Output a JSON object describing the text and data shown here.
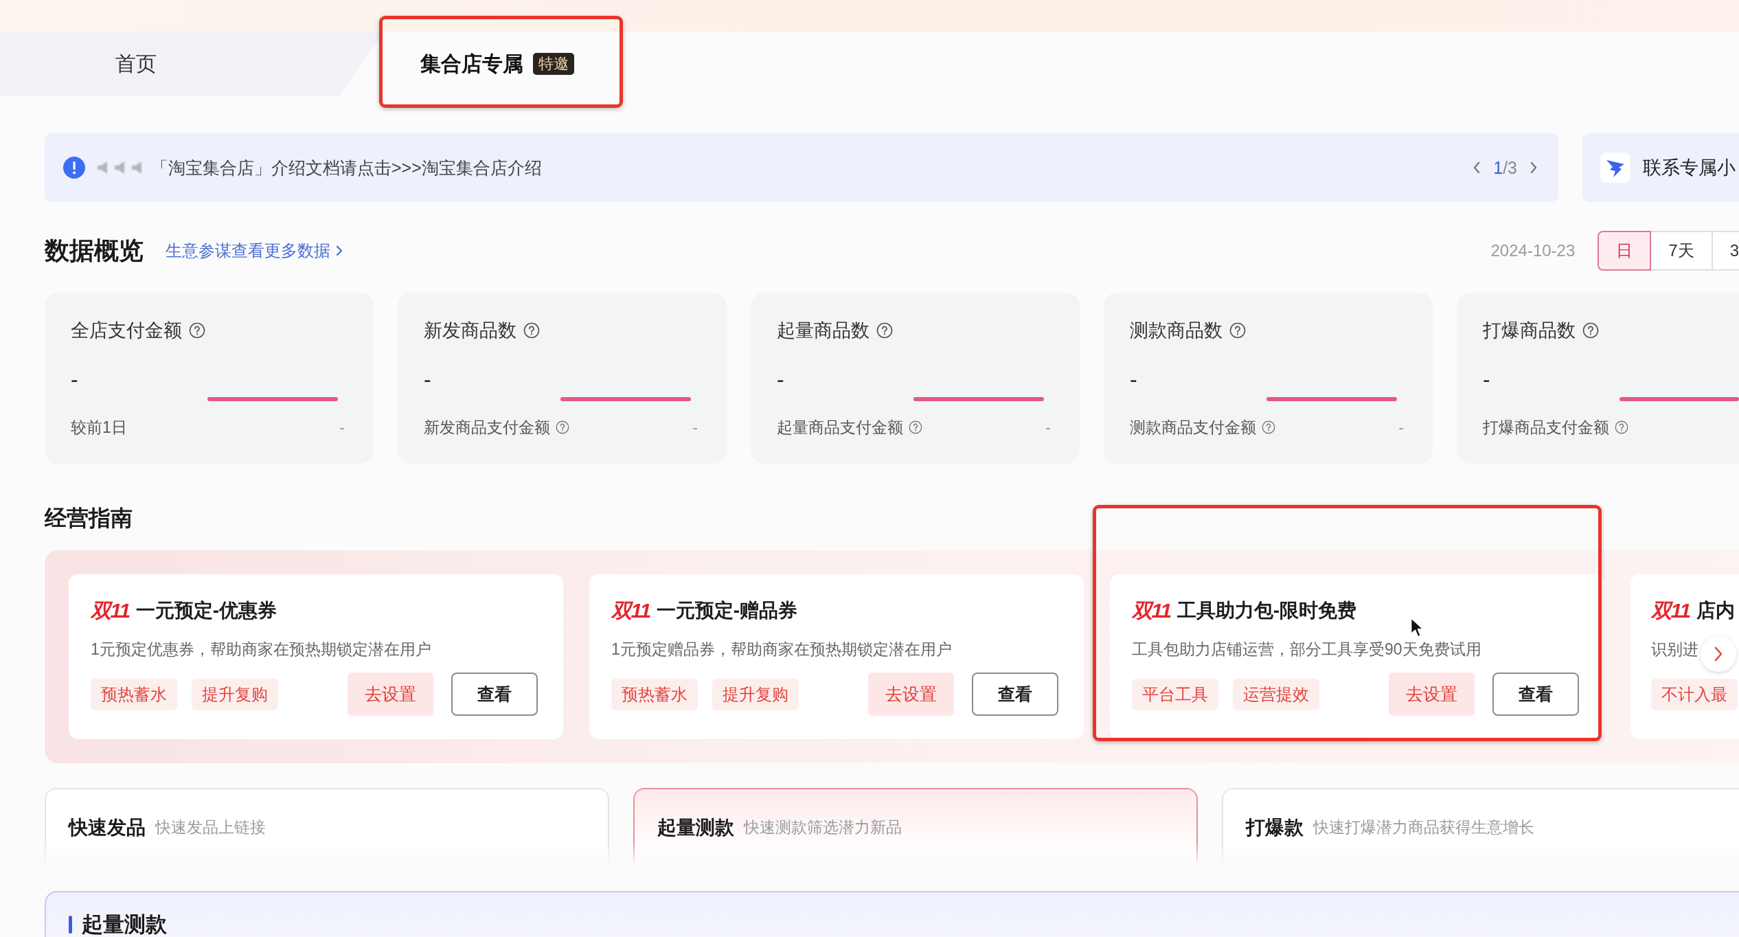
{
  "tabs": [
    {
      "label": "首页",
      "selected": false,
      "highlighted": false
    },
    {
      "label": "集合店专属",
      "badge": "特邀",
      "selected": true,
      "highlighted": true
    }
  ],
  "notice": {
    "text": "「淘宝集合店」介绍文档请点击>>>淘宝集合店介绍",
    "page": "1",
    "page_total": "/3"
  },
  "contact": {
    "label": "联系专属小"
  },
  "overview": {
    "title": "数据概览",
    "link": "生意参谋查看更多数据",
    "date": "2024-10-23",
    "ranges": [
      {
        "label": "日",
        "selected": true
      },
      {
        "label": "7天",
        "selected": false
      },
      {
        "label": "3",
        "selected": false
      }
    ],
    "metrics": [
      {
        "title": "全店支付金额",
        "value": "-",
        "footer_label": "较前1日",
        "footer_help": false,
        "footer_value": "-"
      },
      {
        "title": "新发商品数",
        "value": "-",
        "footer_label": "新发商品支付金额",
        "footer_help": true,
        "footer_value": "-"
      },
      {
        "title": "起量商品数",
        "value": "-",
        "footer_label": "起量商品支付金额",
        "footer_help": true,
        "footer_value": "-"
      },
      {
        "title": "测款商品数",
        "value": "-",
        "footer_label": "测款商品支付金额",
        "footer_help": true,
        "footer_value": "-"
      },
      {
        "title": "打爆商品数",
        "value": "-",
        "footer_label": "打爆商品支付金额",
        "footer_help": true
      }
    ]
  },
  "guide": {
    "title": "经营指南",
    "cards": [
      {
        "logo": "双11",
        "title": "一元预定-优惠券",
        "description": "1元预定优惠券，帮助商家在预热期锁定潜在用户",
        "tags": [
          "预热蓄水",
          "提升复购"
        ],
        "primary": "去设置",
        "secondary": "查看",
        "highlighted": false
      },
      {
        "logo": "双11",
        "title": "一元预定-赠品券",
        "description": "1元预定赠品券，帮助商家在预热期锁定潜在用户",
        "tags": [
          "预热蓄水",
          "提升复购"
        ],
        "primary": "去设置",
        "secondary": "查看",
        "highlighted": false
      },
      {
        "logo": "双11",
        "title": "工具助力包-限时免费",
        "description": "工具包助力店铺运营，部分工具享受90天免费试用",
        "tags": [
          "平台工具",
          "运营提效"
        ],
        "primary": "去设置",
        "secondary": "查看",
        "highlighted": true
      },
      {
        "logo": "双11",
        "title": "店内",
        "description": "识别进",
        "tags": [
          "不计入最"
        ],
        "highlighted": false
      }
    ]
  },
  "quick_entries": [
    {
      "title": "快速发品",
      "subtitle": "快速发品上链接",
      "selected": false
    },
    {
      "title": "起量测款",
      "subtitle": "快速测款筛选潜力新品",
      "selected": true
    },
    {
      "title": "打爆款",
      "subtitle": "快速打爆潜力商品获得生意增长",
      "selected": false
    }
  ],
  "section": {
    "title": "起量测款"
  }
}
